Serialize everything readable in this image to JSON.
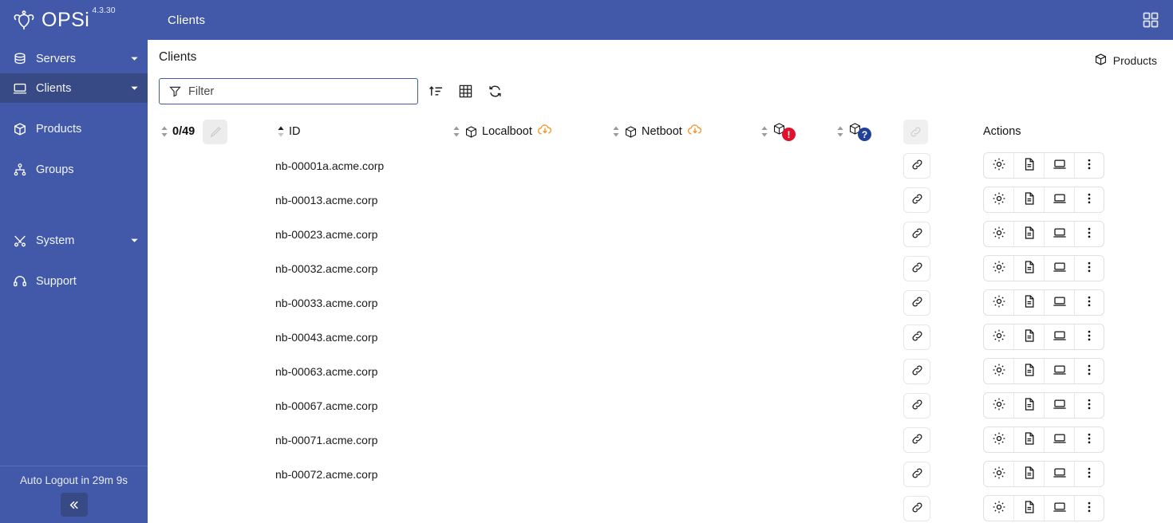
{
  "topbar": {
    "brand_name": "OPSi",
    "version": "4.3.30",
    "page_context": "Clients",
    "apps_icon": "grid-apps-icon"
  },
  "sidebar": {
    "items": [
      {
        "label": "Servers",
        "icon": "database-icon",
        "caret": true,
        "active": false
      },
      {
        "label": "Clients",
        "icon": "monitor-icon",
        "caret": true,
        "active": true
      },
      {
        "label": "Products",
        "icon": "package-icon",
        "caret": false,
        "active": false
      },
      {
        "label": "Groups",
        "icon": "sitemap-icon",
        "caret": false,
        "active": false
      },
      {
        "label": "System",
        "icon": "tools-icon",
        "caret": true,
        "active": false
      },
      {
        "label": "Support",
        "icon": "headset-icon",
        "caret": false,
        "active": false
      }
    ],
    "auto_logout": "Auto Logout in 29m 9s",
    "collapse_icon": "chevron-double-left-icon"
  },
  "page": {
    "title": "Clients",
    "products_button": "Products"
  },
  "toolbar": {
    "filter_placeholder": "Filter",
    "filter_value": "",
    "filter_icon": "funnel-icon",
    "sort_icon": "sort-ascending-icon",
    "columns_icon": "table-grid-icon",
    "refresh_icon": "refresh-icon"
  },
  "table": {
    "selection_count": "0/49",
    "columns": [
      {
        "key": "select",
        "label": "0/49",
        "sort": "none"
      },
      {
        "key": "id",
        "label": "ID",
        "sort": "asc"
      },
      {
        "key": "localboot",
        "label": "Localboot",
        "sort": "none"
      },
      {
        "key": "netboot",
        "label": "Netboot",
        "sort": "none"
      },
      {
        "key": "failed",
        "label": "",
        "sort": "none"
      },
      {
        "key": "unknown",
        "label": "",
        "sort": "none"
      },
      {
        "key": "link",
        "label": "",
        "sort": "none"
      },
      {
        "key": "actions",
        "label": "Actions",
        "sort": "none"
      }
    ],
    "actions_header": "Actions",
    "rows": [
      {
        "id": "nb-00001a.acme.corp"
      },
      {
        "id": "nb-00013.acme.corp"
      },
      {
        "id": "nb-00023.acme.corp"
      },
      {
        "id": "nb-00032.acme.corp"
      },
      {
        "id": "nb-00033.acme.corp"
      },
      {
        "id": "nb-00043.acme.corp"
      },
      {
        "id": "nb-00063.acme.corp"
      },
      {
        "id": "nb-00067.acme.corp"
      },
      {
        "id": "nb-00071.acme.corp"
      },
      {
        "id": "nb-00072.acme.corp"
      },
      {
        "id": ""
      }
    ],
    "row_actions": [
      {
        "name": "settings",
        "icon": "gear-icon"
      },
      {
        "name": "logs",
        "icon": "document-icon"
      },
      {
        "name": "remote-control",
        "icon": "laptop-icon"
      },
      {
        "name": "more",
        "icon": "kebab-menu-icon"
      }
    ]
  },
  "colors": {
    "brand_blue": "#4159a8",
    "sidebar_active": "#374a85",
    "alert_red": "#e0112b",
    "info_blue": "#21409a",
    "download_orange": "#f59324"
  }
}
